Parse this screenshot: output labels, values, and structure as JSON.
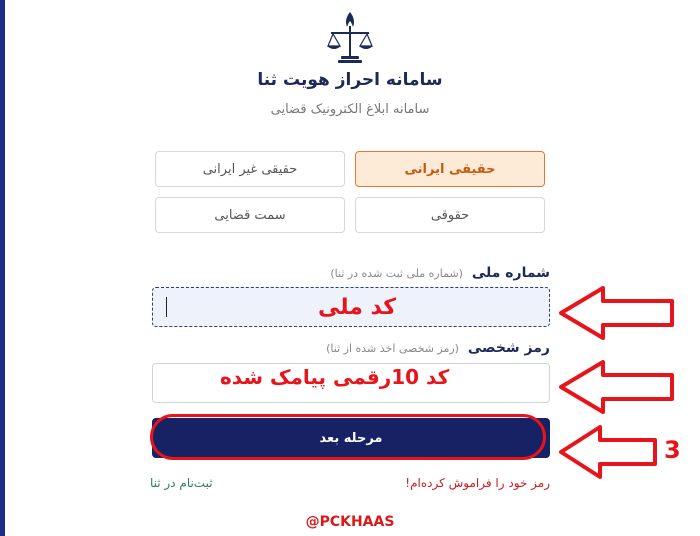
{
  "header": {
    "title": "سامانه احراز هویت ثنا",
    "subtitle": "سامانه ابلاغ الکترونیک قضایی"
  },
  "user_types": [
    {
      "label": "حقیقی ایرانی",
      "active": true
    },
    {
      "label": "حقیقی غیر ایرانی",
      "active": false
    },
    {
      "label": "حقوقی",
      "active": false
    },
    {
      "label": "سمت قضایی",
      "active": false
    }
  ],
  "national_id": {
    "label": "شماره ملی",
    "hint": "(شماره ملی ثبت شده در ثنا)",
    "value": "",
    "overlay_text": "کد ملی"
  },
  "password": {
    "label": "رمز شخصی",
    "hint": "(رمز شخصی اخذ شده از ثنا)",
    "value": "",
    "overlay_text": "کد 10رقمی پیامک شده"
  },
  "submit_label": "مرحله بعد",
  "step_marker": "3",
  "links": {
    "forgot": "رمز خود را فراموش کرده‌ام!",
    "register": "ثبت‌نام در ثنا"
  },
  "watermark": "@PCKHAAS",
  "colors": {
    "primary": "#162263",
    "accent": "#e0782e",
    "annotation": "#e8141c"
  }
}
